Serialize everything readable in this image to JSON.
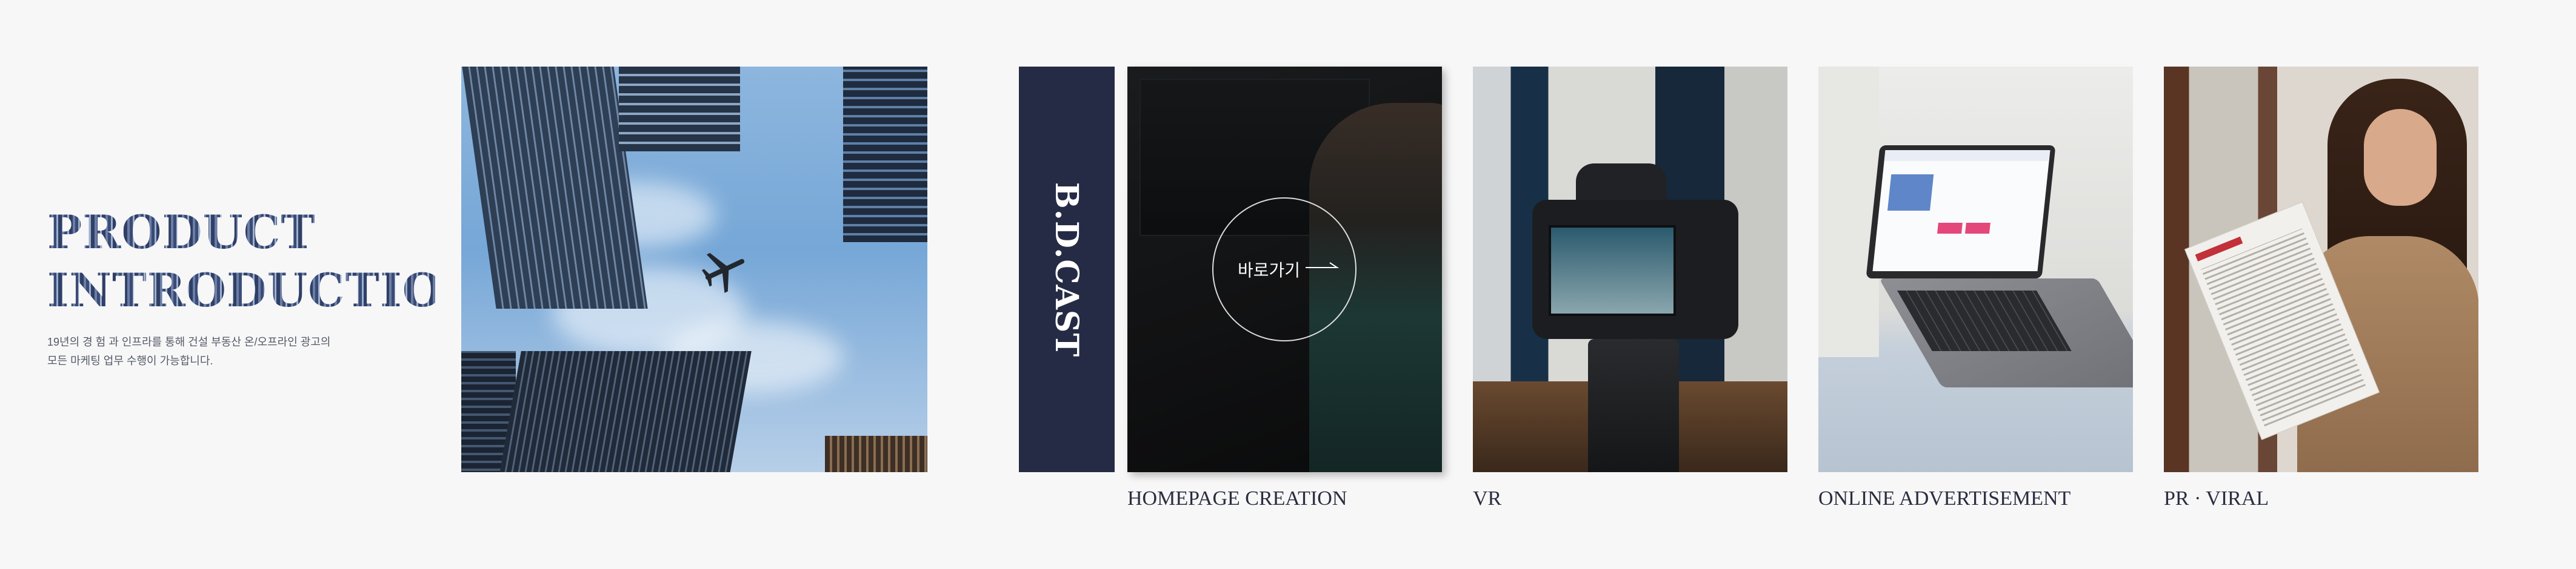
{
  "intro": {
    "title_line1": "PRODUCT",
    "title_line2": "INTRODUCTION",
    "desc_line1": "19년의 경 험 과 인프라를 통해 건설 부동산 온/오프라인 광고의",
    "desc_line2": "모든 마케팅 업무 수행이 가능합니다."
  },
  "brand": {
    "name": "B.D.CAST"
  },
  "cards": [
    {
      "label": "HOMEPAGE CREATION",
      "overlay_text": "바로가기"
    },
    {
      "label": "VR"
    },
    {
      "label": "ONLINE ADVERTISEMENT"
    },
    {
      "label": "PR · VIRAL"
    }
  ],
  "colors": {
    "navy": "#262b45",
    "background": "#f7f7f8"
  }
}
